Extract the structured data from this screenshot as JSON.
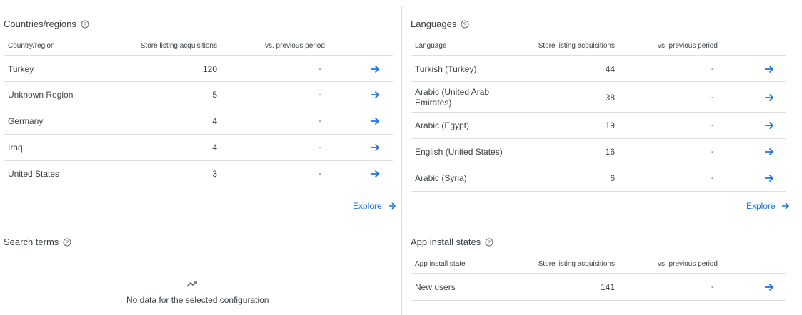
{
  "countries": {
    "title": "Countries/regions",
    "headers": {
      "name": "Country/region",
      "value": "Store listing acquisitions",
      "change": "vs. previous period"
    },
    "rows": [
      {
        "name": "Turkey",
        "value": "120",
        "change": "-"
      },
      {
        "name": "Unknown Region",
        "value": "5",
        "change": "-"
      },
      {
        "name": "Germany",
        "value": "4",
        "change": "-"
      },
      {
        "name": "Iraq",
        "value": "4",
        "change": "-"
      },
      {
        "name": "United States",
        "value": "3",
        "change": "-"
      }
    ],
    "explore_label": "Explore"
  },
  "languages": {
    "title": "Languages",
    "headers": {
      "name": "Language",
      "value": "Store listing acquisitions",
      "change": "vs. previous period"
    },
    "rows": [
      {
        "name": "Turkish (Turkey)",
        "value": "44",
        "change": "-"
      },
      {
        "name": "Arabic (United Arab Emirates)",
        "value": "38",
        "change": "-"
      },
      {
        "name": "Arabic (Egypt)",
        "value": "19",
        "change": "-"
      },
      {
        "name": "English (United States)",
        "value": "16",
        "change": "-"
      },
      {
        "name": "Arabic (Syria)",
        "value": "6",
        "change": "-"
      }
    ],
    "explore_label": "Explore"
  },
  "search_terms": {
    "title": "Search terms",
    "empty_message": "No data for the selected configuration"
  },
  "install_states": {
    "title": "App install states",
    "headers": {
      "name": "App install state",
      "value": "Store listing acquisitions",
      "change": "vs. previous period"
    },
    "rows": [
      {
        "name": "New users",
        "value": "141",
        "change": "-"
      }
    ]
  },
  "colors": {
    "accent": "#1a73e8",
    "divider": "#dadce0",
    "text": "#3c4043"
  },
  "icons": {
    "help": "help-circle-icon",
    "row_link": "arrow-forward-icon",
    "empty": "trending-up-icon"
  }
}
